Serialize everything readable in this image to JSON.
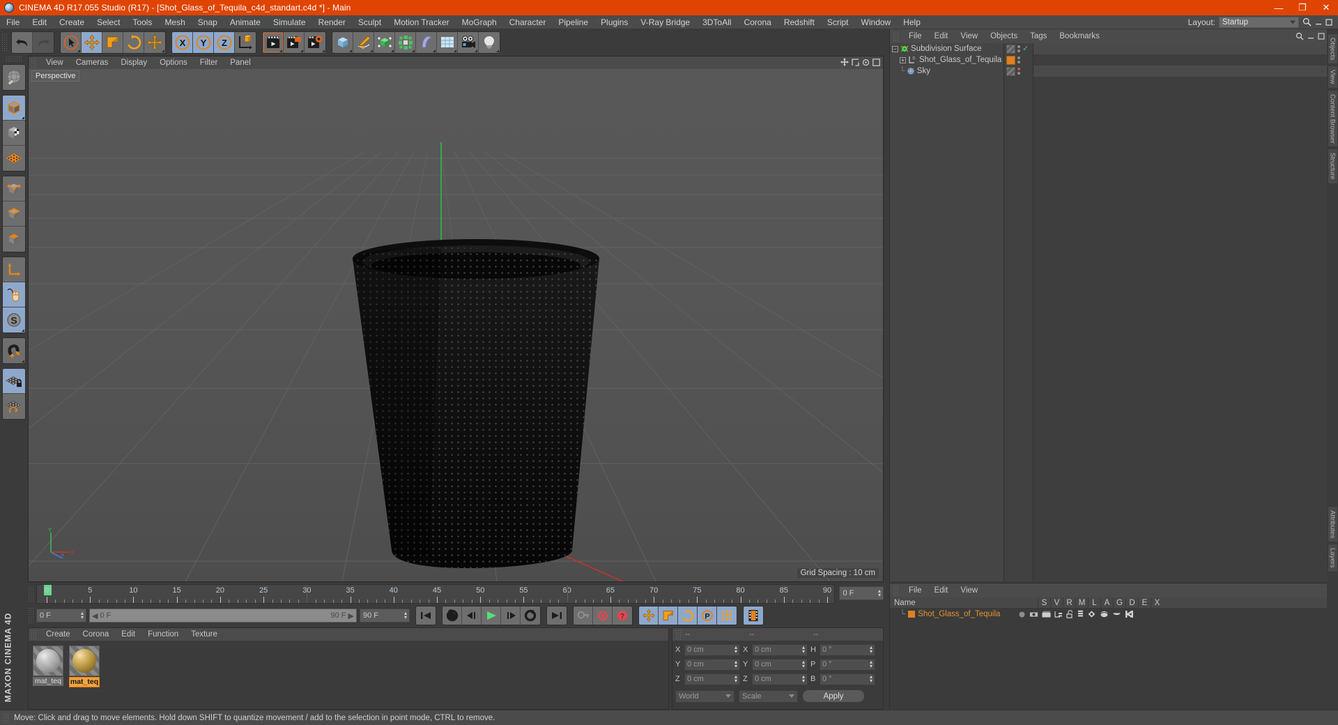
{
  "window": {
    "title": "CINEMA 4D R17.055 Studio (R17) - [Shot_Glass_of_Tequila_c4d_standart.c4d *] - Main",
    "app_icon": "cinema4d-logo-icon",
    "minimize": "—",
    "maximize": "❐",
    "close": "✕",
    "titlebar_color": "#e04403"
  },
  "menubar": {
    "items": [
      {
        "label": "File"
      },
      {
        "label": "Edit"
      },
      {
        "label": "Create"
      },
      {
        "label": "Select"
      },
      {
        "label": "Tools"
      },
      {
        "label": "Mesh"
      },
      {
        "label": "Snap"
      },
      {
        "label": "Animate"
      },
      {
        "label": "Simulate"
      },
      {
        "label": "Render"
      },
      {
        "label": "Sculpt"
      },
      {
        "label": "Motion Tracker"
      },
      {
        "label": "MoGraph"
      },
      {
        "label": "Character"
      },
      {
        "label": "Pipeline"
      },
      {
        "label": "Plugins"
      },
      {
        "label": "V-Ray Bridge"
      },
      {
        "label": "3DToAll"
      },
      {
        "label": "Corona"
      },
      {
        "label": "Redshift"
      },
      {
        "label": "Script"
      },
      {
        "label": "Window"
      },
      {
        "label": "Help"
      }
    ],
    "layout_label": "Layout:",
    "layout_value": "Startup",
    "search_icon": "search-icon"
  },
  "toolbar": {
    "groups": [
      {
        "buttons": [
          {
            "name": "undo-button",
            "icon": "undo-arrow-icon",
            "state": "normal"
          },
          {
            "name": "redo-button",
            "icon": "redo-arrow-icon",
            "state": "dim"
          }
        ]
      },
      {
        "buttons": [
          {
            "name": "live-selection-button",
            "icon": "cursor-circle-icon",
            "state": "normal"
          },
          {
            "name": "move-tool-button",
            "icon": "move-arrows-icon",
            "state": "active"
          },
          {
            "name": "scale-tool-button",
            "icon": "scale-box-icon",
            "state": "normal"
          },
          {
            "name": "rotate-tool-button",
            "icon": "rotate-circle-icon",
            "state": "normal"
          },
          {
            "name": "move-duplicate-button",
            "icon": "move-arrows-icon",
            "state": "normal"
          }
        ]
      },
      {
        "buttons": [
          {
            "name": "x-axis-lock-button",
            "icon": "x-axis-icon",
            "state": "active",
            "label": "X"
          },
          {
            "name": "y-axis-lock-button",
            "icon": "y-axis-icon",
            "state": "active",
            "label": "Y"
          },
          {
            "name": "z-axis-lock-button",
            "icon": "z-axis-icon",
            "state": "active",
            "label": "Z"
          },
          {
            "name": "world-object-coords-button",
            "icon": "world-axis-cube-icon",
            "state": "normal"
          }
        ]
      },
      {
        "buttons": [
          {
            "name": "render-view-button",
            "icon": "clapperboard-icon",
            "state": "normal"
          },
          {
            "name": "render-region-button",
            "icon": "clapperboard-region-icon",
            "state": "normal"
          },
          {
            "name": "render-settings-button",
            "icon": "clapperboard-gear-icon",
            "state": "normal"
          }
        ]
      },
      {
        "buttons": [
          {
            "name": "primitive-cube-button",
            "icon": "blue-cube-icon",
            "state": "normal"
          },
          {
            "name": "spline-pen-button",
            "icon": "pen-spline-icon",
            "state": "normal"
          },
          {
            "name": "nurbs-button",
            "icon": "green-cube-cage-icon",
            "state": "normal"
          },
          {
            "name": "array-button",
            "icon": "green-array-icon",
            "state": "normal"
          },
          {
            "name": "deformer-button",
            "icon": "bend-deformer-icon",
            "state": "normal"
          },
          {
            "name": "environment-button",
            "icon": "floor-grid-icon",
            "state": "normal"
          },
          {
            "name": "camera-button",
            "icon": "camera-icon",
            "state": "normal"
          },
          {
            "name": "light-button",
            "icon": "light-bulb-icon",
            "state": "normal"
          }
        ]
      }
    ]
  },
  "left_toolbar": {
    "groups": [
      {
        "buttons": [
          {
            "name": "make-editable-button",
            "icon": "globe-wire-icon",
            "state": "normal"
          }
        ]
      },
      {
        "buttons": [
          {
            "name": "model-mode-button",
            "icon": "model-cube-icon",
            "state": "active"
          },
          {
            "name": "texture-mode-button",
            "icon": "texture-checker-cube-icon",
            "state": "normal"
          },
          {
            "name": "workplane-mode-button",
            "icon": "workplane-grid-icon",
            "state": "normal"
          }
        ]
      },
      {
        "buttons": [
          {
            "name": "points-mode-button",
            "icon": "points-cube-icon",
            "state": "normal"
          },
          {
            "name": "edges-mode-button",
            "icon": "edges-cube-icon",
            "state": "normal"
          },
          {
            "name": "polygons-mode-button",
            "icon": "polygons-cube-icon",
            "state": "normal"
          }
        ]
      },
      {
        "buttons": [
          {
            "name": "object-axis-button",
            "icon": "axis-arrow-icon",
            "state": "normal"
          },
          {
            "name": "viewport-solo-button",
            "icon": "mouse-icon",
            "state": "active"
          },
          {
            "name": "soft-selection-button",
            "icon": "s-disc-icon",
            "state": "active"
          }
        ]
      },
      {
        "buttons": [
          {
            "name": "snap-magnet-button",
            "icon": "magnet-icon",
            "state": "normal"
          }
        ]
      },
      {
        "buttons": [
          {
            "name": "lock-workplane-button",
            "icon": "grid-lock-icon",
            "state": "active"
          },
          {
            "name": "planar-workplane-button",
            "icon": "grid-rotate-icon",
            "state": "normal"
          }
        ]
      }
    ],
    "brand": "MAXON CINEMA 4D"
  },
  "viewport": {
    "menu": [
      {
        "label": "View"
      },
      {
        "label": "Cameras"
      },
      {
        "label": "Display"
      },
      {
        "label": "Options"
      },
      {
        "label": "Filter"
      },
      {
        "label": "Panel"
      }
    ],
    "view_label": "Perspective",
    "grid_spacing": "Grid Spacing : 10 cm",
    "axis_y": "Y",
    "axis_x": "X",
    "axis_z": "Z",
    "corner_icons": [
      "move-view-icon",
      "scale-view-icon",
      "rotate-view-icon",
      "maximize-view-icon"
    ]
  },
  "timeline": {
    "ticks": [
      {
        "value": "0",
        "pos": 0
      },
      {
        "value": "5",
        "pos": 5
      },
      {
        "value": "10",
        "pos": 10
      },
      {
        "value": "15",
        "pos": 15
      },
      {
        "value": "20",
        "pos": 20
      },
      {
        "value": "25",
        "pos": 25
      },
      {
        "value": "30",
        "pos": 30
      },
      {
        "value": "35",
        "pos": 35
      },
      {
        "value": "40",
        "pos": 40
      },
      {
        "value": "45",
        "pos": 45
      },
      {
        "value": "50",
        "pos": 50
      },
      {
        "value": "55",
        "pos": 55
      },
      {
        "value": "60",
        "pos": 60
      },
      {
        "value": "65",
        "pos": 65
      },
      {
        "value": "70",
        "pos": 70
      },
      {
        "value": "75",
        "pos": 75
      },
      {
        "value": "80",
        "pos": 80
      },
      {
        "value": "85",
        "pos": 85
      },
      {
        "value": "90",
        "pos": 90
      }
    ],
    "min_frame": 0,
    "max_frame": 90,
    "current_frame_field": "0 F"
  },
  "animbar": {
    "current_frame": "0 F",
    "range_start": "0 F",
    "range_end": "90 F",
    "end_frame": "90 F",
    "transport": [
      {
        "name": "go-to-start-button",
        "icon": "skip-back-icon"
      },
      {
        "name": "play-reverse-loop-button",
        "icon": "loop-back-icon"
      },
      {
        "name": "step-back-button",
        "icon": "prev-frame-icon"
      },
      {
        "name": "play-button",
        "icon": "play-icon"
      },
      {
        "name": "step-forward-button",
        "icon": "next-frame-icon"
      },
      {
        "name": "play-forward-loop-button",
        "icon": "loop-forward-icon"
      },
      {
        "name": "go-to-end-button",
        "icon": "skip-forward-icon"
      }
    ],
    "keys": [
      {
        "name": "autokey-button",
        "icon": "key-icon"
      },
      {
        "name": "record-active-objects-button",
        "icon": "record-circle-icon"
      },
      {
        "name": "keyframe-selection-button",
        "icon": "question-circle-icon"
      }
    ],
    "tracks": [
      {
        "name": "position-key-button",
        "icon": "move-arrows-icon",
        "state": "active"
      },
      {
        "name": "scale-key-button",
        "icon": "scale-box-icon",
        "state": "active"
      },
      {
        "name": "rotation-key-button",
        "icon": "rotate-circle-icon",
        "state": "active"
      },
      {
        "name": "parameter-key-button",
        "icon": "p-circle-icon",
        "state": "active"
      },
      {
        "name": "point-level-animation-button",
        "icon": "dot-grid-icon",
        "state": "active"
      }
    ],
    "extra": [
      {
        "name": "timeline-toggle-button",
        "icon": "filmstrip-icon",
        "state": "active"
      }
    ]
  },
  "material_manager": {
    "menu": [
      {
        "label": "Create"
      },
      {
        "label": "Corona"
      },
      {
        "label": "Edit"
      },
      {
        "label": "Function"
      },
      {
        "label": "Texture"
      }
    ],
    "materials": [
      {
        "name": "mat_teq",
        "selected": false,
        "color": "#cfcfcf"
      },
      {
        "name": "mat_teq",
        "selected": true,
        "color": "#c8a24c"
      }
    ]
  },
  "coordinates": {
    "headers": [
      "--",
      "--",
      "--"
    ],
    "rows": [
      {
        "label1": "X",
        "value1": "0 cm",
        "label2": "X",
        "value2": "0 cm",
        "label3": "H",
        "value3": "0 °"
      },
      {
        "label1": "Y",
        "value1": "0 cm",
        "label2": "Y",
        "value2": "0 cm",
        "label3": "P",
        "value3": "0 °"
      },
      {
        "label1": "Z",
        "value1": "0 cm",
        "label2": "Z",
        "value2": "0 cm",
        "label3": "B",
        "value3": "0 °"
      }
    ],
    "system": "World",
    "mode": "Scale",
    "apply_label": "Apply"
  },
  "object_manager": {
    "menu": [
      {
        "label": "File"
      },
      {
        "label": "Edit"
      },
      {
        "label": "View"
      },
      {
        "label": "Objects"
      },
      {
        "label": "Tags"
      },
      {
        "label": "Bookmarks"
      }
    ],
    "right_icons": [
      "search-icon",
      "minimize-icon",
      "restore-icon",
      "close-icon"
    ],
    "objects": [
      {
        "name": "Subdivision Surface",
        "icon": "subdivision-surface-icon",
        "depth": 0,
        "expander": "-",
        "tags": [
          "checker-tag",
          "visibility-dots",
          "green-check"
        ]
      },
      {
        "name": "Shot_Glass_of_Tequila",
        "icon": "null-object-icon",
        "depth": 1,
        "expander": "+",
        "tags": [
          "orange-material-tag",
          "visibility-dots"
        ]
      },
      {
        "name": "Sky",
        "icon": "sky-sphere-icon",
        "depth": 1,
        "expander": "",
        "tags": [
          "checker-tag",
          "red-dot",
          "visibility-dots"
        ]
      }
    ]
  },
  "tag_panel": {
    "menu": [
      {
        "label": "File"
      },
      {
        "label": "Edit"
      },
      {
        "label": "View"
      }
    ],
    "header_name": "Name",
    "columns": [
      "S",
      "V",
      "R",
      "M",
      "L",
      "A",
      "G",
      "D",
      "E",
      "X"
    ],
    "rows": [
      {
        "name": "Shot_Glass_of_Tequila",
        "swatch": "#e08022"
      }
    ]
  },
  "right_tabs": [
    {
      "label": "Objects"
    },
    {
      "label": "View"
    },
    {
      "label": "Content Browser"
    },
    {
      "label": "Structure"
    },
    {
      "label": "Attributes"
    },
    {
      "label": "Layers"
    }
  ],
  "statusbar": {
    "message": "Move: Click and drag to move elements. Hold down SHIFT to quantize movement / add to the selection in point mode, CTRL to remove."
  }
}
